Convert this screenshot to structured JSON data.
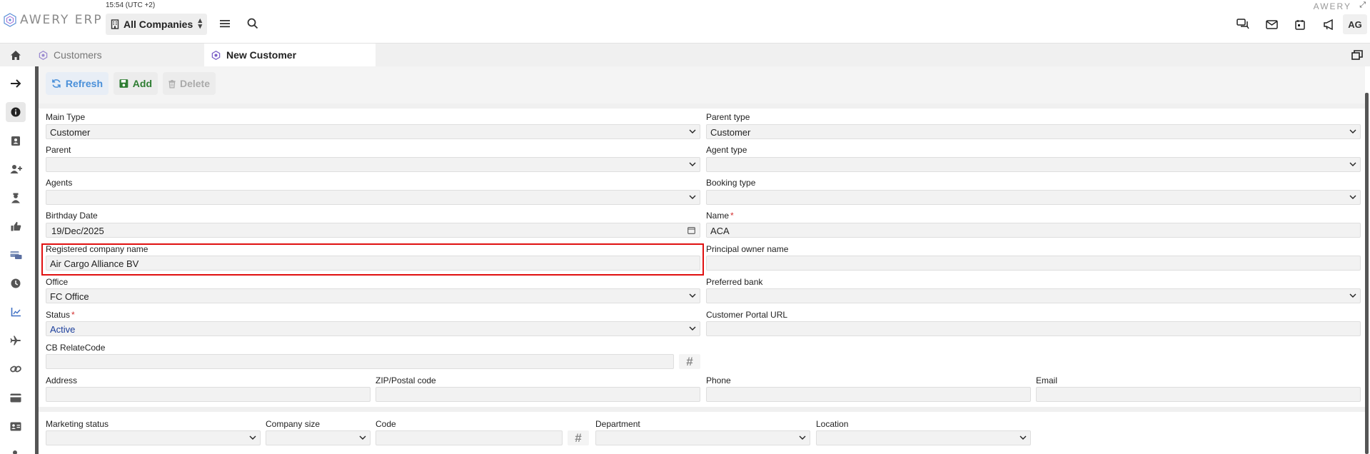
{
  "header": {
    "clock": "15:54 (UTC +2)",
    "logo_text": "AWERY ERP",
    "brand_right": "AWERY",
    "company_select": "All Companies",
    "avatar": "AG"
  },
  "tabs": [
    {
      "label": "Customers"
    },
    {
      "label": "New Customer"
    }
  ],
  "toolbar": {
    "refresh": "Refresh",
    "add": "Add",
    "delete": "Delete"
  },
  "form": {
    "main_type": {
      "label": "Main Type",
      "value": "Customer"
    },
    "parent_type": {
      "label": "Parent type",
      "value": "Customer"
    },
    "parent": {
      "label": "Parent",
      "value": ""
    },
    "agent_type": {
      "label": "Agent type",
      "value": ""
    },
    "agents": {
      "label": "Agents",
      "value": ""
    },
    "booking_type": {
      "label": "Booking type",
      "value": ""
    },
    "birthday_date": {
      "label": "Birthday Date",
      "value": "19/Dec/2025"
    },
    "name": {
      "label": "Name",
      "value": "ACA"
    },
    "registered_company_name": {
      "label": "Registered company name",
      "value": "Air Cargo Alliance BV"
    },
    "principal_owner_name": {
      "label": "Principal owner name",
      "value": ""
    },
    "office": {
      "label": "Office",
      "value": "FC Office"
    },
    "preferred_bank": {
      "label": "Preferred bank",
      "value": ""
    },
    "status": {
      "label": "Status",
      "value": "Active"
    },
    "customer_portal_url": {
      "label": "Customer Portal URL",
      "value": ""
    },
    "cb_relate_code": {
      "label": "CB RelateCode",
      "value": ""
    },
    "address": {
      "label": "Address",
      "value": ""
    },
    "zip": {
      "label": "ZIP/Postal code",
      "value": ""
    },
    "phone": {
      "label": "Phone",
      "value": ""
    },
    "email": {
      "label": "Email",
      "value": ""
    },
    "marketing_status": {
      "label": "Marketing status",
      "value": ""
    },
    "company_size": {
      "label": "Company size",
      "value": ""
    },
    "code": {
      "label": "Code",
      "value": ""
    },
    "department": {
      "label": "Department",
      "value": ""
    },
    "location": {
      "label": "Location",
      "value": ""
    },
    "required_mark": "*",
    "hash_symbol": "#"
  }
}
